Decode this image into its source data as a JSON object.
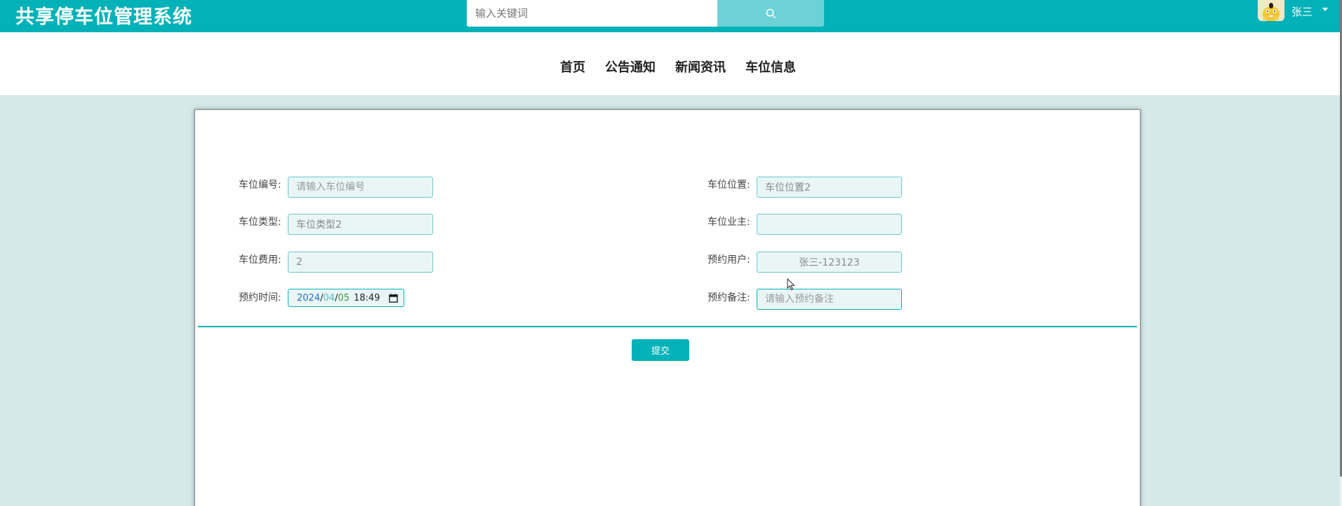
{
  "header": {
    "site_title": "共享停车位管理系统",
    "search_placeholder": "输入关键词",
    "search_icon": "search-icon",
    "user_name": "张三",
    "user_menu_icon": "caret-down-icon"
  },
  "nav": {
    "items": [
      {
        "label": "首页"
      },
      {
        "label": "公告通知"
      },
      {
        "label": "新闻资讯"
      },
      {
        "label": "车位信息"
      }
    ]
  },
  "form": {
    "fields": {
      "spot_number": {
        "label": "车位编号:",
        "placeholder": "请输入车位编号",
        "value": ""
      },
      "spot_type": {
        "label": "车位类型:",
        "value": "车位类型2"
      },
      "spot_fee": {
        "label": "车位费用:",
        "value": "2"
      },
      "reserve_time": {
        "label": "预约时间:",
        "year": "2024",
        "month": "04",
        "day": "05",
        "time": "18:49",
        "separator": "/"
      },
      "spot_location": {
        "label": "车位位置:",
        "value": "车位位置2"
      },
      "spot_owner": {
        "label": "车位业主:",
        "value": ""
      },
      "reserve_user": {
        "label": "预约用户:",
        "value": "张三-123123"
      },
      "reserve_note": {
        "label": "预约备注:",
        "placeholder": "请输入预约备注",
        "value": ""
      }
    },
    "submit_label": "提交"
  },
  "colors": {
    "primary": "#03b2b8",
    "page_background": "#d5e9e9",
    "input_background": "#eaf6f6"
  }
}
